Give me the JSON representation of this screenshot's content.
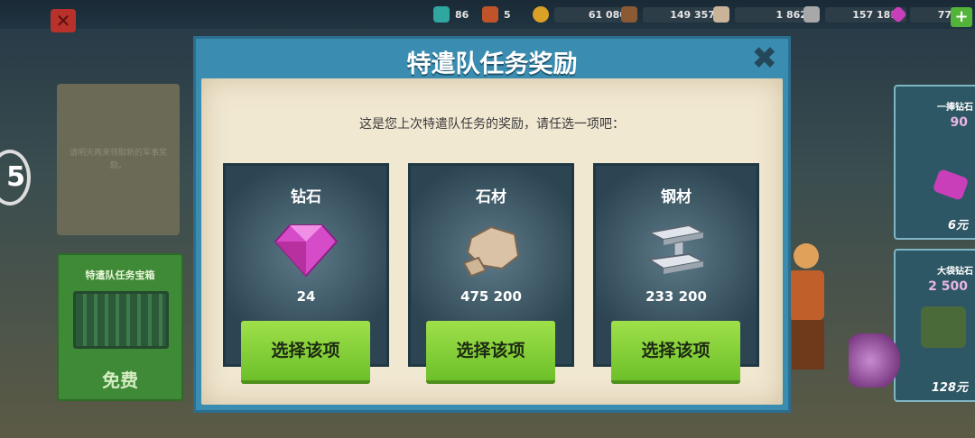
{
  "topbar": {
    "resources": [
      {
        "icon": "builder-icon",
        "value": "86",
        "color": "#2fa6a0"
      },
      {
        "icon": "medal-icon",
        "value": "5",
        "color": "#c0532a"
      },
      {
        "icon": "gold-coin-icon",
        "value": "61 080",
        "color": "#d9a126"
      },
      {
        "icon": "wood-icon",
        "value": "149 357",
        "color": "#8a5a34"
      },
      {
        "icon": "stone-icon",
        "value": "1 862",
        "color": "#c9b49a"
      },
      {
        "icon": "iron-icon",
        "value": "157 181",
        "color": "#a8a8a8"
      },
      {
        "icon": "diamond-icon",
        "value": "77",
        "color": "#c93fb9"
      }
    ]
  },
  "left_panel": {
    "notice": "请明天再来领取新的军事奖励。",
    "chest_title": "特遣队任务宝箱",
    "chest_action": "免费"
  },
  "right_panel": {
    "offers": [
      {
        "title": "一捧钻石",
        "amount": "90",
        "price": "6元"
      },
      {
        "title": "大袋钻石",
        "amount": "2 500",
        "price": "128元"
      }
    ]
  },
  "modal": {
    "title": "特遣队任务奖励",
    "subtitle": "这是您上次特遣队任务的奖励，请任选一项吧：",
    "options": [
      {
        "name": "钻石",
        "amount": "24",
        "button": "选择该项",
        "icon": "diamond-icon",
        "color": "#d64bc8"
      },
      {
        "name": "石材",
        "amount": "475 200",
        "button": "选择该项",
        "icon": "stone-icon",
        "color": "#d9c2a6"
      },
      {
        "name": "钢材",
        "amount": "233 200",
        "button": "选择该项",
        "icon": "steel-beam-icon",
        "color": "#b9c2cc"
      }
    ]
  },
  "side_number": "5"
}
